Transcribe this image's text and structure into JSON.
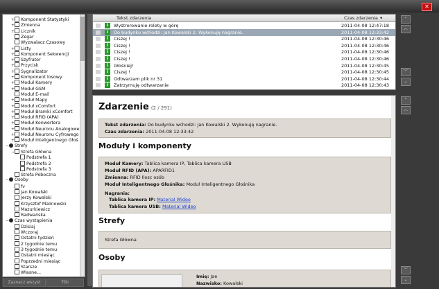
{
  "window": {
    "close_symbol": "✕"
  },
  "tree": [
    {
      "indent": 1,
      "expander": "+",
      "check": true,
      "label": "Komponent Statystyki"
    },
    {
      "indent": 1,
      "expander": "+",
      "check": true,
      "label": "Zmienna"
    },
    {
      "indent": 1,
      "expander": "+",
      "check": true,
      "label": "Licznik"
    },
    {
      "indent": 1,
      "expander": "",
      "check": true,
      "label": "Zegar"
    },
    {
      "indent": 1,
      "expander": "",
      "check": false,
      "label": "Wyzwalacz Czasowy"
    },
    {
      "indent": 1,
      "expander": "+",
      "check": true,
      "label": "Listy"
    },
    {
      "indent": 1,
      "expander": "+",
      "check": true,
      "label": "Komponent Sekwencji"
    },
    {
      "indent": 1,
      "expander": "+",
      "check": true,
      "label": "Szyfrator"
    },
    {
      "indent": 1,
      "expander": "+",
      "check": true,
      "label": "Przycisk"
    },
    {
      "indent": 1,
      "expander": "+",
      "check": true,
      "label": "Sygnalizator"
    },
    {
      "indent": 1,
      "expander": "+",
      "check": true,
      "label": "Komponent losowy"
    },
    {
      "indent": 1,
      "expander": "+",
      "check": true,
      "label": "Moduł Kamery"
    },
    {
      "indent": 1,
      "expander": "+",
      "check": true,
      "label": "Moduł GSM"
    },
    {
      "indent": 1,
      "expander": "",
      "check": true,
      "label": "Moduł E-mail"
    },
    {
      "indent": 1,
      "expander": "+",
      "check": true,
      "label": "Moduł Mapy"
    },
    {
      "indent": 1,
      "expander": "+",
      "check": true,
      "label": "Moduł xComfort"
    },
    {
      "indent": 1,
      "expander": "+",
      "check": true,
      "label": "Moduł Bramki xComfort"
    },
    {
      "indent": 1,
      "expander": "+",
      "check": true,
      "label": "Moduł RFID (APA)"
    },
    {
      "indent": 1,
      "expander": "+",
      "check": true,
      "label": "Moduł Konwertera"
    },
    {
      "indent": 1,
      "expander": "+",
      "check": true,
      "label": "Moduł Neuronu Analogowe"
    },
    {
      "indent": 1,
      "expander": "+",
      "check": true,
      "label": "Moduł Neuronu Cyfrowego"
    },
    {
      "indent": 1,
      "expander": "+",
      "check": true,
      "label": "Moduł Inteligentnego Głoś"
    },
    {
      "indent": 0,
      "expander": "−",
      "icon": "group",
      "label": "Strefy"
    },
    {
      "indent": 1,
      "expander": "−",
      "check": true,
      "label": "Strefa Główna"
    },
    {
      "indent": 2,
      "expander": "",
      "check": true,
      "label": "Podstrefa 1"
    },
    {
      "indent": 2,
      "expander": "",
      "check": true,
      "label": "Podstrefa 2"
    },
    {
      "indent": 2,
      "expander": "",
      "check": true,
      "label": "Podstrefa 3"
    },
    {
      "indent": 1,
      "expander": "",
      "check": true,
      "label": "Strefa Poboczna"
    },
    {
      "indent": 0,
      "expander": "−",
      "icon": "person",
      "label": "Osoby"
    },
    {
      "indent": 1,
      "expander": "",
      "check": true,
      "label": "fv"
    },
    {
      "indent": 1,
      "expander": "",
      "check": true,
      "label": "Jan Kowalski"
    },
    {
      "indent": 1,
      "expander": "",
      "check": true,
      "label": "Jerzy Kowalski"
    },
    {
      "indent": 1,
      "expander": "",
      "check": true,
      "label": "Krzysztof Malinowski"
    },
    {
      "indent": 1,
      "expander": "",
      "check": true,
      "label": "Mazurkiewicz"
    },
    {
      "indent": 1,
      "expander": "",
      "check": true,
      "label": "Radwańska"
    },
    {
      "indent": 0,
      "expander": "−",
      "icon": "clock",
      "label": "Czas wystąpienia"
    },
    {
      "indent": 1,
      "expander": "",
      "check": true,
      "label": "Dzisiaj"
    },
    {
      "indent": 1,
      "expander": "",
      "check": true,
      "label": "Wczoraj"
    },
    {
      "indent": 1,
      "expander": "",
      "check": true,
      "label": "Ostatni tydzień"
    },
    {
      "indent": 1,
      "expander": "",
      "check": true,
      "label": "2 tygodnie temu"
    },
    {
      "indent": 1,
      "expander": "",
      "check": true,
      "label": "3 tygodnie temu"
    },
    {
      "indent": 1,
      "expander": "",
      "check": true,
      "label": "Ostatni miesiąc"
    },
    {
      "indent": 1,
      "expander": "",
      "check": true,
      "label": "Poprzedni miesiąc"
    },
    {
      "indent": 1,
      "expander": "",
      "check": true,
      "label": "Starsze"
    },
    {
      "indent": 1,
      "expander": "",
      "check": false,
      "label": "Własne..."
    }
  ],
  "bottom": {
    "left": "Zaznacz wszyst",
    "right": "Filtr"
  },
  "events": {
    "col_event": "Tekst zdarzenia",
    "col_time": "Czas zdarzenia",
    "sort_symbol": "▾",
    "rows": [
      {
        "text": "Wystrerowanie rolety w górę",
        "time": "2011-04-08 12:47:18",
        "selected": false
      },
      {
        "text": "Do budynku wchodzi: Jan Kowalski 2. Wykonuję nagranie.",
        "time": "2011-04-08 12:33:42",
        "selected": true
      },
      {
        "text": "Ciszej !",
        "time": "2011-04-08 12:30:46",
        "selected": false
      },
      {
        "text": "Ciszej !",
        "time": "2011-04-08 12:30:46",
        "selected": false
      },
      {
        "text": "Ciszej !",
        "time": "2011-04-08 12:30:46",
        "selected": false
      },
      {
        "text": "Ciszej !",
        "time": "2011-04-08 12:30:46",
        "selected": false
      },
      {
        "text": "Głośniej!",
        "time": "2011-04-08 12:30:45",
        "selected": false
      },
      {
        "text": "Ciszej !",
        "time": "2011-04-08 12:30:45",
        "selected": false
      },
      {
        "text": "Odtwarzam plik nr 31",
        "time": "2011-04-08 12:30:44",
        "selected": false
      },
      {
        "text": "Zatrzymuję odtwarzanie",
        "time": "2011-04-08 12:30:43",
        "selected": false
      }
    ]
  },
  "nav": {
    "top": "⌃",
    "up": "︿",
    "down": "﹀",
    "bottom": "⌄"
  },
  "detail": {
    "title": "Zdarzenie",
    "count": "(2 / 291)",
    "event_label": "Tekst zdarzenia:",
    "event_value": "Do budynku wchodzi: Jan Kowalski 2. Wykonuję nagranie.",
    "time_label": "Czas zdarzenia:",
    "time_value": "2011-04-08 12:33:42",
    "modules_title": "Moduły i komponenty",
    "m_camera_label": "Moduł Kamery:",
    "m_camera_value": "Tablica kamera IP, Tablica kamera USB",
    "m_rfid_label": "Moduł RFID (APA):",
    "m_rfid_value": "APARFID1",
    "m_var_label": "Zmienna:",
    "m_var_value": "RFID Ilosc osób",
    "m_speaker_label": "Moduł Inteligentnego Głośnika:",
    "m_speaker_value": "Moduł Inteligentnego Głośnika",
    "recordings_label": "Nagrania:",
    "rec_ip_label": "Tablica kamera IP:",
    "rec_ip_link": "Material Wideo",
    "rec_usb_label": "Tablica kamera USB:",
    "rec_usb_link": "Material Wideo",
    "zones_title": "Strefy",
    "zones_value": "Strefa Główna",
    "people_title": "Osoby",
    "first_name_label": "Imię:",
    "first_name_value": "Jan",
    "last_name_label": "Nazwisko:",
    "last_name_value": "Kowalski"
  }
}
